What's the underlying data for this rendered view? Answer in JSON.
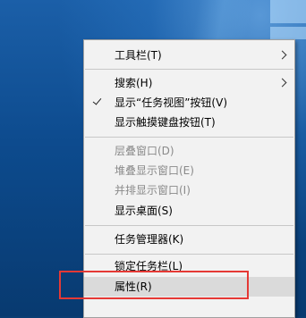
{
  "context_menu": {
    "items": [
      {
        "label": "工具栏(T)",
        "enabled": true,
        "submenu": true
      },
      {
        "label": "搜索(H)",
        "enabled": true,
        "submenu": true
      },
      {
        "label": "显示“任务视图”按钮(V)",
        "enabled": true,
        "checked": true
      },
      {
        "label": "显示触摸键盘按钮(T)",
        "enabled": true
      },
      {
        "label": "层叠窗口(D)",
        "enabled": false
      },
      {
        "label": "堆叠显示窗口(E)",
        "enabled": false
      },
      {
        "label": "并排显示窗口(I)",
        "enabled": false
      },
      {
        "label": "显示桌面(S)",
        "enabled": true
      },
      {
        "label": "任务管理器(K)",
        "enabled": true
      },
      {
        "label": "锁定任务栏(L)",
        "enabled": true
      },
      {
        "label": "属性(R)",
        "enabled": true,
        "highlighted": true
      }
    ]
  },
  "annotation": {
    "color": "#e53935",
    "target": "属性(R)"
  }
}
